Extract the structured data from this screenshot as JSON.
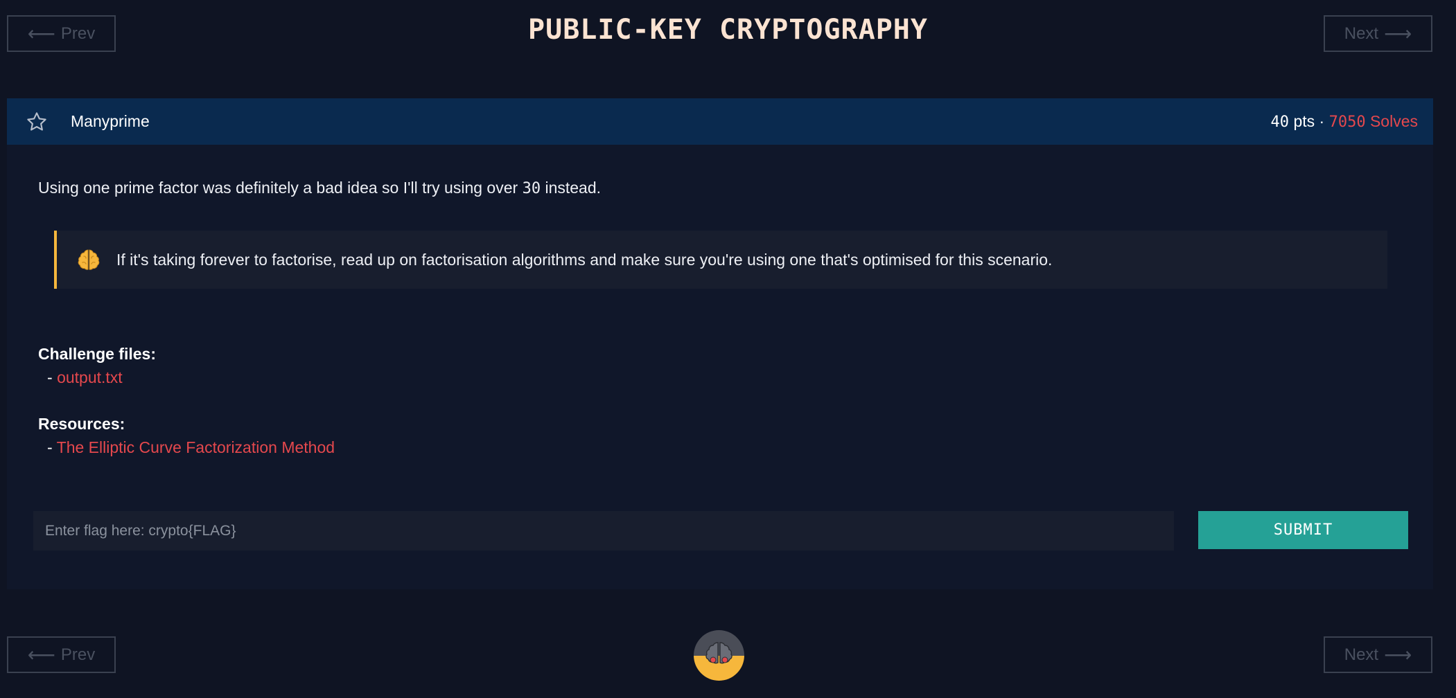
{
  "nav": {
    "prev_label": "Prev",
    "next_label": "Next",
    "prev_arrow": "⟵",
    "next_arrow": "⟶"
  },
  "page_title": "PUBLIC-KEY CRYPTOGRAPHY",
  "challenge": {
    "name": "Manyprime",
    "points": "40",
    "points_suffix": "pts",
    "separator": "·",
    "solves_count": "7050",
    "solves_suffix": "Solves",
    "description_before": "Using one prime factor was definitely a bad idea so I'll try using over ",
    "description_number": "30",
    "description_after": " instead.",
    "hint": "If it's taking forever to factorise, read up on factorisation algorithms and make sure you're using one that's optimised for this scenario.",
    "files_label": "Challenge files:",
    "files": [
      "output.txt"
    ],
    "resources_label": "Resources:",
    "resources": [
      "The Elliptic Curve Factorization Method"
    ],
    "list_prefix": "- "
  },
  "flag_form": {
    "placeholder": "Enter flag here: crypto{FLAG}",
    "submit_label": "SUBMIT"
  },
  "colors": {
    "background": "#0f1423",
    "header_bar": "#0a2a4f",
    "accent_red": "#e5484d",
    "accent_teal": "#25a196",
    "hint_border": "#f6b73c"
  },
  "icons": {
    "favorite": "star-icon",
    "hint": "brain-icon",
    "logo": "brain-logo-icon"
  }
}
